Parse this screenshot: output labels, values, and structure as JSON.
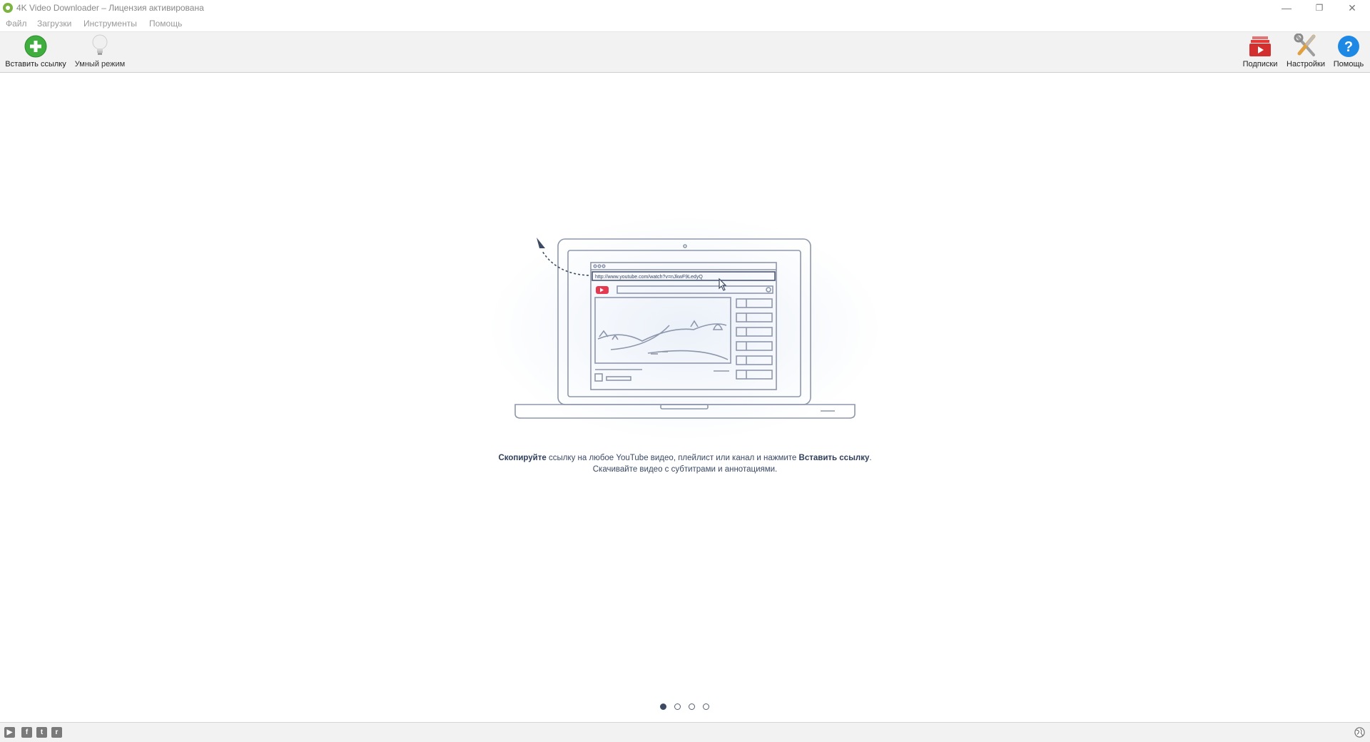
{
  "window": {
    "title": "4K Video Downloader – Лицензия активирована",
    "minimize_glyph": "—",
    "maximize_glyph": "❐",
    "close_glyph": "✕"
  },
  "menu": [
    {
      "label": "Файл"
    },
    {
      "label": "Загрузки"
    },
    {
      "label": "Инструменты"
    },
    {
      "label": "Помощь"
    }
  ],
  "toolbar": {
    "paste_link": {
      "label": "Вставить ссылку",
      "icon": "plus-circle-icon",
      "color": "#3fae3f"
    },
    "smart_mode": {
      "label": "Умный режим",
      "icon": "lightbulb-icon"
    },
    "subscriptions": {
      "label": "Подписки",
      "icon": "youtube-stack-icon",
      "color": "#d32f2f"
    },
    "settings": {
      "label": "Настройки",
      "icon": "tools-icon"
    },
    "help": {
      "label": "Помощь",
      "icon": "question-circle-icon",
      "color": "#1e88e5"
    }
  },
  "illustration": {
    "url_text": "http://www.youtube.com/watch?v=nJkwF9LedyQ"
  },
  "hint": {
    "line1_bold_start": "Скопируйте",
    "line1_middle": " ссылку на любое YouTube видео, плейлист или канал и нажмите ",
    "line1_bold_end": "Вставить ссылку",
    "line1_end": ".",
    "line2": "Скачивайте видео с субтитрами и аннотациями."
  },
  "pager": {
    "count": 4,
    "active": 1
  },
  "statusbar": {
    "social": [
      {
        "name": "youtube",
        "glyph": "▶"
      },
      {
        "name": "facebook",
        "glyph": "f"
      },
      {
        "name": "twitter",
        "glyph": "t"
      },
      {
        "name": "reddit",
        "glyph": "r"
      }
    ]
  }
}
